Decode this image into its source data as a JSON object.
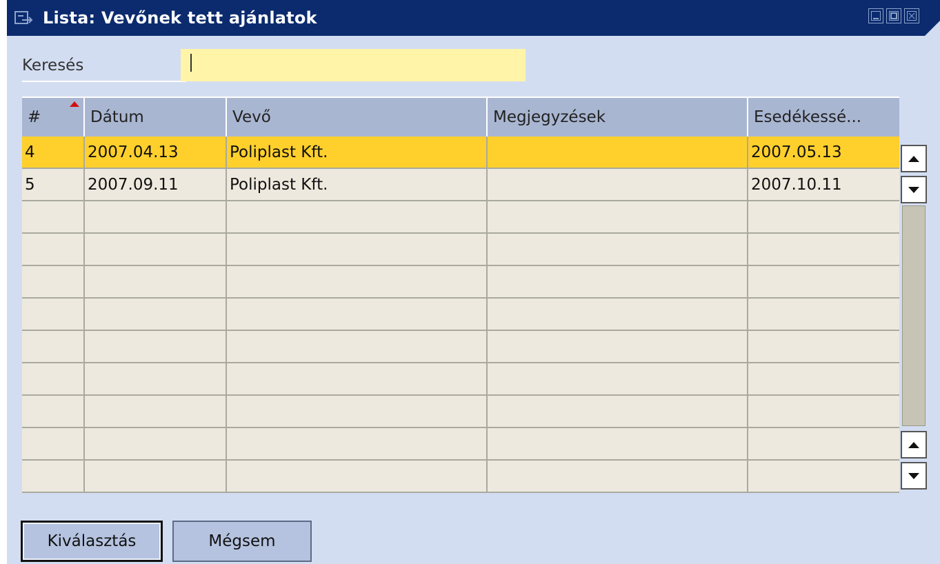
{
  "window": {
    "title": "Lista: Vevőnek tett ajánlatok",
    "title_icon": "form-icon",
    "controls": [
      "minimize-icon",
      "maximize-icon",
      "close-icon"
    ],
    "titlebar_color": "#0b2b6e"
  },
  "search": {
    "label": "Keresés",
    "value": ""
  },
  "table": {
    "columns": [
      "#",
      "Dátum",
      "Vevő",
      "Megjegyzések",
      "Esedékessé..."
    ],
    "sort_column": "#",
    "rows": [
      {
        "num": "4",
        "date": "2007.04.13",
        "customer": "Poliplast Kft.",
        "notes": "",
        "due": "2007.05.13",
        "selected": true
      },
      {
        "num": "5",
        "date": "2007.09.11",
        "customer": "Poliplast Kft.",
        "notes": "",
        "due": "2007.10.11",
        "selected": false
      }
    ],
    "selected_color": "#ffd02c"
  },
  "buttons": {
    "choose": "Kiválasztás",
    "cancel": "Mégsem"
  }
}
